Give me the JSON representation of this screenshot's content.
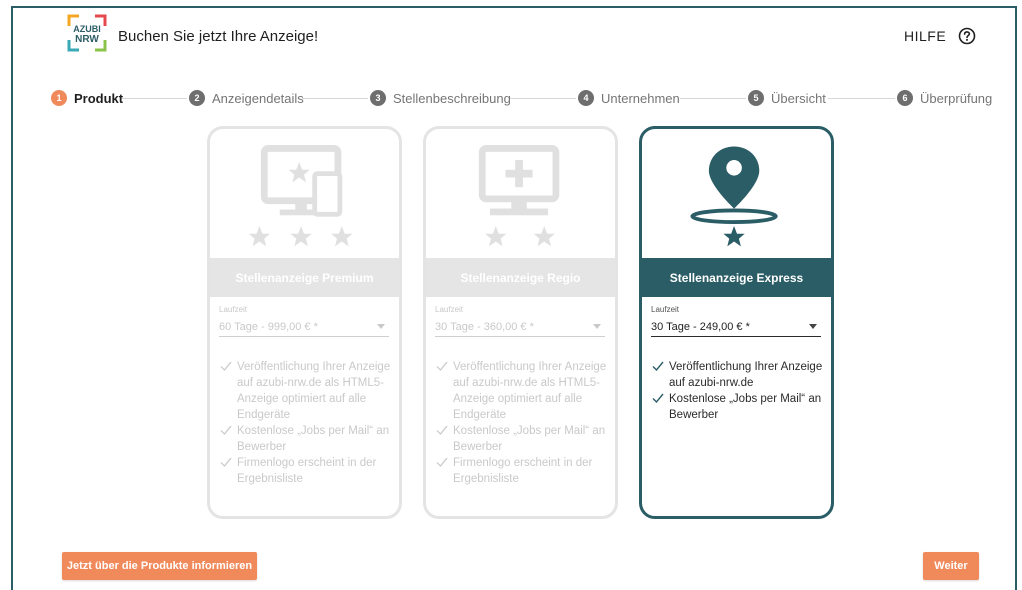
{
  "header": {
    "logo_text": [
      "AZUBI",
      "NRW"
    ],
    "title": "Buchen Sie jetzt Ihre Anzeige!",
    "help_label": "HILFE"
  },
  "steps": [
    {
      "num": "1",
      "label": "Produkt",
      "active": true
    },
    {
      "num": "2",
      "label": "Anzeigendetails",
      "active": false
    },
    {
      "num": "3",
      "label": "Stellenbeschreibung",
      "active": false
    },
    {
      "num": "4",
      "label": "Unternehmen",
      "active": false
    },
    {
      "num": "5",
      "label": "Übersicht",
      "active": false
    },
    {
      "num": "6",
      "label": "Überprüfung",
      "active": false
    }
  ],
  "products": [
    {
      "title": "Stellenanzeige Premium",
      "icon": "desktop-and-phone-star-icon",
      "stars": 3,
      "duration_label": "Laufzeit",
      "duration_value": "60 Tage - 999,00 € *",
      "selected": false,
      "features": [
        "Veröffentlichung Ihrer Anzeige auf azubi-nrw.de als HTML5-Anzeige optimiert auf alle Endgeräte",
        "Kostenlose „Jobs per Mail“ an Bewerber",
        "Firmenlogo erscheint in der Ergebnisliste"
      ]
    },
    {
      "title": "Stellenanzeige Regio",
      "icon": "desktop-plus-icon",
      "stars": 2,
      "duration_label": "Laufzeit",
      "duration_value": "30 Tage - 360,00 € *",
      "selected": false,
      "features": [
        "Veröffentlichung Ihrer Anzeige auf azubi-nrw.de als HTML5-Anzeige optimiert auf alle Endgeräte",
        "Kostenlose „Jobs per Mail“ an Bewerber",
        "Firmenlogo erscheint in der Ergebnisliste"
      ]
    },
    {
      "title": "Stellenanzeige Express",
      "icon": "map-pin-icon",
      "stars": 1,
      "duration_label": "Laufzeit",
      "duration_value": "30 Tage - 249,00 € *",
      "selected": true,
      "features": [
        "Veröffentlichung Ihrer Anzeige auf azubi-nrw.de",
        "Kostenlose „Jobs per Mail“ an Bewerber"
      ]
    }
  ],
  "footer": {
    "info_button": "Jetzt über die Produkte informieren",
    "next_button": "Weiter"
  },
  "colors": {
    "accent": "#f18a5b",
    "primary": "#2b5d66",
    "disabled": "#e4e4e4"
  }
}
